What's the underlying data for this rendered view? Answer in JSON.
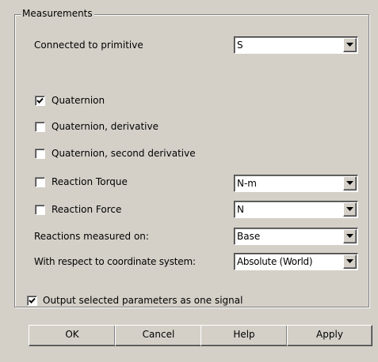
{
  "group": {
    "title": "Measurements"
  },
  "connected": {
    "label": "Connected to primitive",
    "value": "S"
  },
  "options": [
    {
      "label": "Quaternion",
      "checked": true
    },
    {
      "label": "Quaternion, derivative",
      "checked": false
    },
    {
      "label": "Quaternion, second derivative",
      "checked": false
    },
    {
      "label": "Reaction Torque",
      "checked": false,
      "unit": "N-m"
    },
    {
      "label": "Reaction Force",
      "checked": false,
      "unit": "N"
    }
  ],
  "reactions": {
    "label": "Reactions measured on:",
    "value": "Base"
  },
  "coord": {
    "label": "With respect to coordinate system:",
    "value": "Absolute (World)"
  },
  "output": {
    "label": "Output selected parameters as one signal",
    "checked": true
  },
  "buttons": {
    "ok": "OK",
    "cancel": "Cancel",
    "help": "Help",
    "apply": "Apply"
  }
}
